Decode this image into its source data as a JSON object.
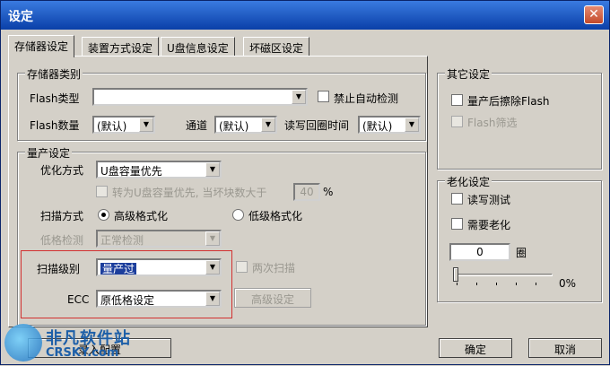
{
  "window": {
    "title": "设定",
    "close_glyph": "✕"
  },
  "tabs": [
    {
      "label": "存储器设定",
      "active": true
    },
    {
      "label": "装置方式设定",
      "active": false
    },
    {
      "label": "U盘信息设定",
      "active": false
    },
    {
      "label": "坏磁区设定",
      "active": false
    }
  ],
  "storage_group": {
    "title": "存储器类别",
    "flash_type_label": "Flash类型",
    "flash_type_value": "",
    "disable_autodetect_label": "禁止自动检测",
    "flash_count_label": "Flash数量",
    "flash_count_value": "(默认)",
    "channel_label": "通道",
    "channel_value": "(默认)",
    "rw_loop_label": "读写回圈时间",
    "rw_loop_value": "(默认)"
  },
  "production_group": {
    "title": "量产设定",
    "optimize_label": "优化方式",
    "optimize_value": "U盘容量优先",
    "switch_capacity_label": "转为U盘容量优先, 当坏块数大于",
    "switch_capacity_value": "40",
    "switch_capacity_unit": "%",
    "scan_mode_label": "扫描方式",
    "high_format_label": "高级格式化",
    "low_format_label": "低级格式化",
    "low_detect_label": "低格检测",
    "low_detect_value": "正常检测",
    "scan_level_label": "扫描级别",
    "scan_level_value": "量产过",
    "double_scan_label": "两次扫描",
    "ecc_label": "ECC",
    "ecc_value": "原低格设定",
    "advanced_button": "高级设定"
  },
  "other_group": {
    "title": "其它设定",
    "erase_after_label": "量产后擦除Flash",
    "flash_filter_label": "Flash筛选"
  },
  "aging_group": {
    "title": "老化设定",
    "rw_test_label": "读写测试",
    "need_aging_label": "需要老化",
    "cycles_value": "0",
    "cycles_unit": "圈",
    "slider_value": "0%"
  },
  "footer": {
    "left_button": "录入配置",
    "ok_button": "确定",
    "cancel_button": "取消"
  },
  "watermark": {
    "line1": "非凡软件站",
    "line2": "CRSKY.com"
  },
  "colors": {
    "title_bar": "#0a3fa8",
    "highlight_box": "#d23030",
    "selection": "#1c3e9c"
  }
}
